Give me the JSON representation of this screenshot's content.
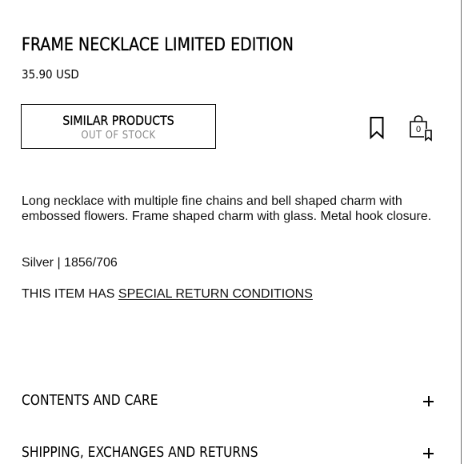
{
  "product": {
    "title": "FRAME NECKLACE LIMITED EDITION",
    "price": "35.90 USD"
  },
  "actions": {
    "similar_label": "SIMILAR PRODUCTS",
    "stock_status": "OUT OF STOCK",
    "bookmark_icon": "bookmark-icon",
    "bag_icon": "shopping-bag-icon",
    "bag_count": "0"
  },
  "details": {
    "description": "Long necklace with multiple fine chains and bell shaped charm with embossed flowers. Frame shaped charm with glass. Metal hook closure.",
    "color_ref": "Silver | 1856/706",
    "return_prefix": "THIS ITEM HAS ",
    "return_link": "SPECIAL RETURN CONDITIONS"
  },
  "accordions": [
    {
      "label": "CONTENTS AND CARE",
      "icon": "plus-icon"
    },
    {
      "label": "SHIPPING, EXCHANGES AND RETURNS",
      "icon": "plus-icon"
    }
  ]
}
